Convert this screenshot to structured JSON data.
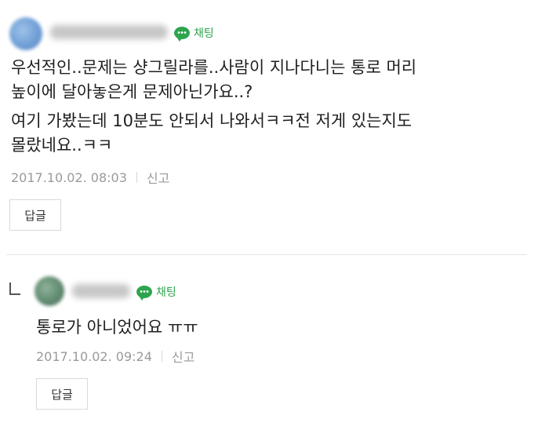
{
  "comments": [
    {
      "badge": "채팅",
      "lines": [
        "우선적인..문제는 샹그릴라를..사람이 지나다니는 통로 머리",
        "높이에 달아놓은게 문제아닌가요..?",
        "여기 가봤는데 10분도 안되서 나와서ㅋㅋ전 저게 있는지도",
        "몰랐네요..ㅋㅋ"
      ],
      "timestamp": "2017.10.02. 08:03",
      "report": "신고",
      "reply_button": "답글"
    },
    {
      "badge": "채팅",
      "lines": [
        "통로가 아니었어요 ㅠㅠ"
      ],
      "timestamp": "2017.10.02. 09:24",
      "report": "신고",
      "reply_button": "답글"
    }
  ],
  "icons": {
    "chat": "chat-bubble-icon",
    "reply": "reply-arrow-icon"
  },
  "colors": {
    "badge": "#2ea44f",
    "meta": "#9a9a9a",
    "text": "#1f1f1f"
  }
}
